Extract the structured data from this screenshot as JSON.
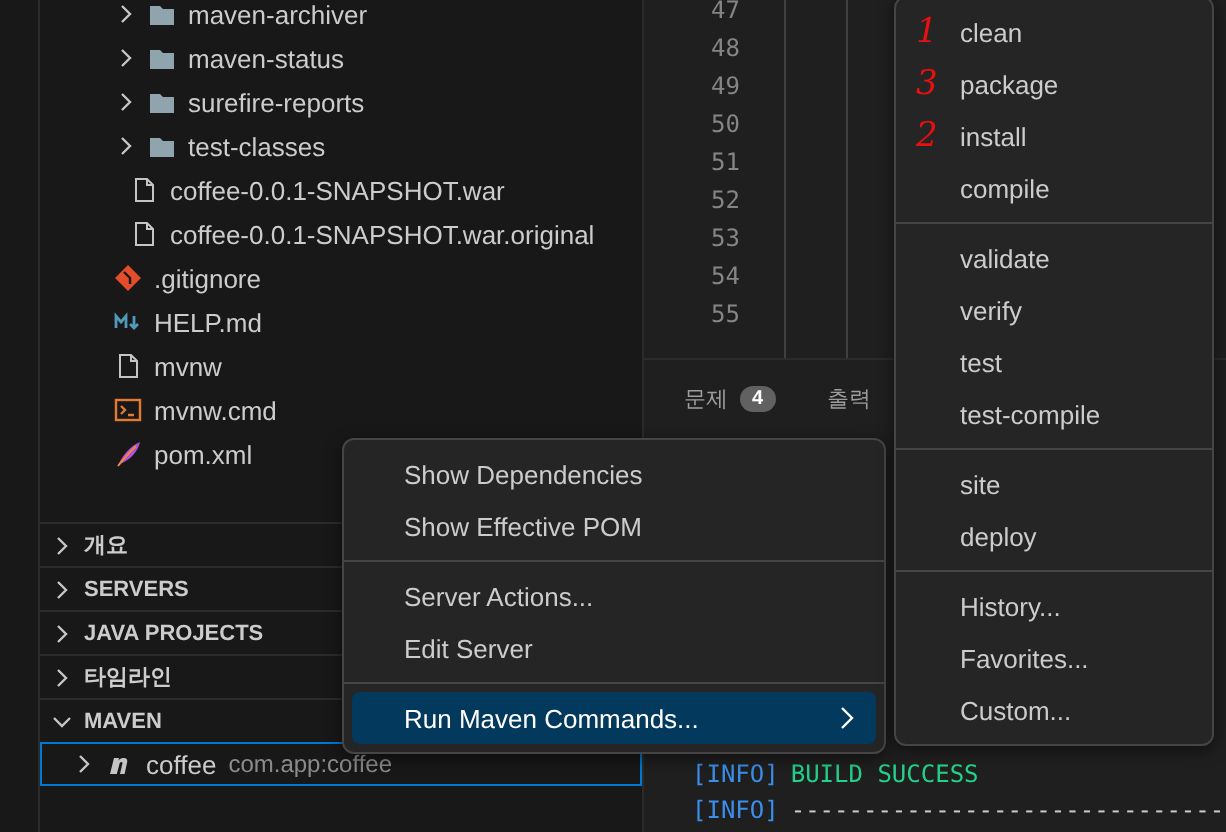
{
  "explorer": {
    "items": [
      {
        "kind": "group",
        "children": [
          {
            "kind": "folder",
            "label": "maven-archiver",
            "expanded": false
          },
          {
            "kind": "folder",
            "label": "maven-status",
            "expanded": false
          },
          {
            "kind": "folder",
            "label": "surefire-reports",
            "expanded": false
          },
          {
            "kind": "folder",
            "label": "test-classes",
            "expanded": false
          },
          {
            "kind": "file",
            "label": "coffee-0.0.1-SNAPSHOT.war"
          },
          {
            "kind": "file",
            "label": "coffee-0.0.1-SNAPSHOT.war.original"
          }
        ]
      },
      {
        "kind": "git",
        "label": ".gitignore"
      },
      {
        "kind": "markdown",
        "label": "HELP.md"
      },
      {
        "kind": "file",
        "label": "mvnw"
      },
      {
        "kind": "terminal",
        "label": "mvnw.cmd"
      },
      {
        "kind": "xml",
        "label": "pom.xml"
      }
    ]
  },
  "sections": [
    {
      "label": "개요",
      "expanded": false
    },
    {
      "label": "SERVERS",
      "expanded": false
    },
    {
      "label": "JAVA PROJECTS",
      "expanded": false
    },
    {
      "label": "타임라인",
      "expanded": false
    },
    {
      "label": "MAVEN",
      "expanded": true,
      "children": [
        {
          "label": "coffee",
          "description": "com.app:coffee",
          "selected": true
        }
      ]
    }
  ],
  "editor": {
    "line_numbers": [
      "47",
      "48",
      "49",
      "50",
      "51",
      "52",
      "53",
      "54",
      "55"
    ]
  },
  "panel": {
    "tabs": [
      {
        "label": "문제",
        "badge": "4"
      },
      {
        "label": "출력"
      }
    ],
    "terminal": [
      {
        "tag": "[INFO]",
        "text": "BUILD SUCCESS",
        "kind": "success"
      },
      {
        "tag": "[INFO]",
        "text": "------------------------------",
        "kind": "rule"
      }
    ]
  },
  "context_menu": {
    "groups": [
      [
        {
          "label": "Show Dependencies",
          "selected": false
        },
        {
          "label": "Show Effective POM",
          "selected": false
        }
      ],
      [
        {
          "label": "Server Actions...",
          "selected": false
        },
        {
          "label": "Edit Server",
          "selected": false
        }
      ],
      [
        {
          "label": "Run Maven Commands...",
          "selected": true,
          "submenu": true
        }
      ]
    ]
  },
  "submenu": {
    "groups": [
      [
        {
          "label": "clean",
          "annotation": "1"
        },
        {
          "label": "package",
          "annotation": "3"
        },
        {
          "label": "install",
          "annotation": "2"
        },
        {
          "label": "compile"
        }
      ],
      [
        {
          "label": "validate"
        },
        {
          "label": "verify"
        },
        {
          "label": "test"
        },
        {
          "label": "test-compile"
        }
      ],
      [
        {
          "label": "site"
        },
        {
          "label": "deploy"
        }
      ],
      [
        {
          "label": "History..."
        },
        {
          "label": "Favorites..."
        },
        {
          "label": "Custom..."
        }
      ]
    ]
  }
}
